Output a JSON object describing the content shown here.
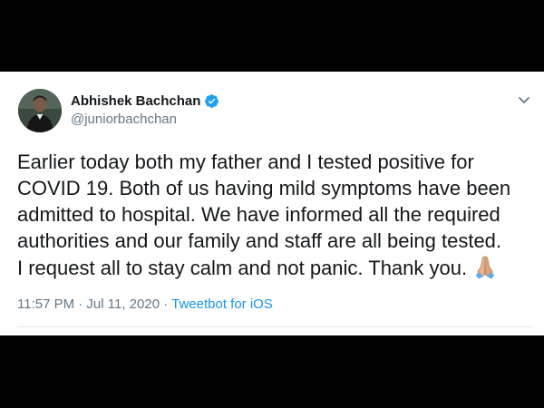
{
  "tweet": {
    "author": {
      "display_name": "Abhishek Bachchan",
      "handle": "@juniorbachchan",
      "verified": true,
      "avatar_icon": "profile-photo"
    },
    "text_lines": [
      "Earlier today both my father and I tested positive for",
      "COVID 19. Both of us having mild symptoms have been",
      "admitted to hospital. We have informed all the required",
      "authorities and our family and staff are all being tested.",
      "I request all to stay calm and not panic. Thank you."
    ],
    "emoji": "folded-hands-icon",
    "timestamp": "11:57 PM · Jul 11, 2020",
    "separator": " · ",
    "source": "Tweetbot for iOS"
  },
  "colors": {
    "text": "#14171a",
    "secondary": "#657786",
    "link": "#1b95e0",
    "verified": "#1da1f2",
    "divider": "#e1e8ed",
    "letterbox": "#000000"
  }
}
